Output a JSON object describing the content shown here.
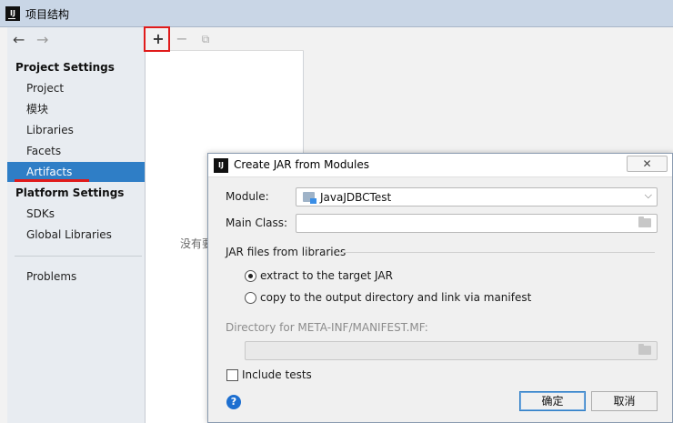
{
  "window": {
    "title": "项目结构",
    "logo": "IJ"
  },
  "nav": {
    "back_icon": "←",
    "forward_icon": "→"
  },
  "sidebar": {
    "project_settings_header": "Project Settings",
    "project_items": [
      {
        "label": "Project"
      },
      {
        "label": "模块"
      },
      {
        "label": "Libraries"
      },
      {
        "label": "Facets"
      },
      {
        "label": "Artifacts",
        "selected": true
      }
    ],
    "platform_settings_header": "Platform Settings",
    "platform_items": [
      {
        "label": "SDKs"
      },
      {
        "label": "Global Libraries"
      }
    ],
    "problems_label": "Problems"
  },
  "toolbar": {
    "add_icon": "+",
    "remove_icon": "−",
    "copy_icon": "⧉"
  },
  "middle": {
    "empty_text": "没有要"
  },
  "dialog": {
    "title": "Create JAR from Modules",
    "logo": "IJ",
    "module_label": "Module:",
    "module_value": "JavaJDBCTest",
    "main_class_label": "Main Class:",
    "main_class_value": "",
    "jar_group_label": "JAR files from libraries",
    "radio_extract_label": "extract to the target JAR",
    "radio_copy_label": "copy to the output directory and link via manifest",
    "selected_radio": "extract",
    "manifest_dir_label": "Directory for META-INF/MANIFEST.MF:",
    "manifest_dir_value": "",
    "include_tests_label": "Include tests",
    "include_tests_checked": false,
    "help_icon": "?",
    "ok_label": "确定",
    "cancel_label": "取消",
    "close_icon": "✕"
  },
  "colors": {
    "selection": "#2f7ec6",
    "annotation_red": "#e01b1b",
    "help_blue": "#1d6fd0"
  }
}
